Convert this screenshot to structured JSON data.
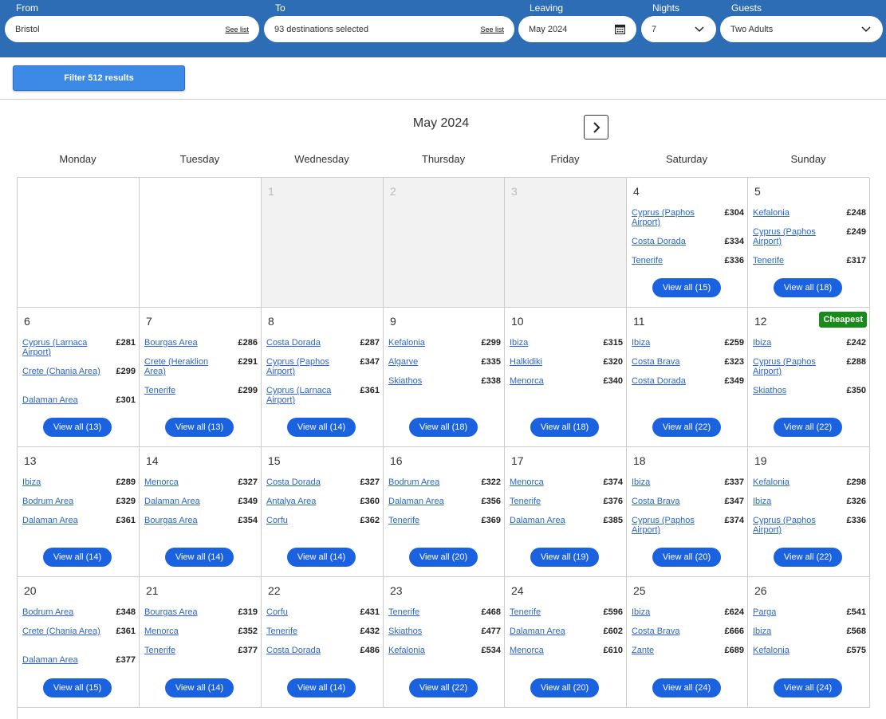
{
  "search": {
    "from": {
      "label": "From",
      "value": "Bristol",
      "see_list": "See list"
    },
    "to": {
      "label": "To",
      "value": "93 destinations selected",
      "see_list": "See list"
    },
    "leaving": {
      "label": "Leaving",
      "value": "May 2024",
      "icon": "calendar-icon"
    },
    "nights": {
      "label": "Nights",
      "value": "7",
      "icon": "chevron-down-icon"
    },
    "guests": {
      "label": "Guests",
      "value": "Two Adults",
      "icon": "chevron-down-icon"
    }
  },
  "filter_button": "Filter 512 results",
  "calendar": {
    "month": "May 2024",
    "next_icon": "chevron-right-icon",
    "weekdays": [
      "Monday",
      "Tuesday",
      "Wednesday",
      "Thursday",
      "Friday",
      "Saturday",
      "Sunday"
    ],
    "cheapest_label": "Cheapest",
    "weeks": [
      [
        {
          "day": "",
          "past": false,
          "entries": []
        },
        {
          "day": "",
          "past": false,
          "entries": []
        },
        {
          "day": "1",
          "past": true,
          "entries": []
        },
        {
          "day": "2",
          "past": true,
          "entries": []
        },
        {
          "day": "3",
          "past": true,
          "entries": []
        },
        {
          "day": "4",
          "past": false,
          "entries": [
            {
              "dest": "Cyprus (Paphos Airport)",
              "price": "£304"
            },
            {
              "dest": "Costa Dorada",
              "price": "£334"
            },
            {
              "dest": "Tenerife",
              "price": "£336"
            }
          ],
          "view_all": "View all (15)"
        },
        {
          "day": "5",
          "past": false,
          "entries": [
            {
              "dest": "Kefalonia",
              "price": "£248"
            },
            {
              "dest": "Cyprus (Paphos Airport)",
              "price": "£249"
            },
            {
              "dest": "Tenerife",
              "price": "£317"
            }
          ],
          "view_all": "View all (18)"
        }
      ],
      [
        {
          "day": "6",
          "past": false,
          "entries": [
            {
              "dest": "Cyprus (Larnaca Airport)",
              "price": "£281"
            },
            {
              "dest": "Crete (Chania Area)",
              "price": "£299"
            },
            {
              "dest": "Dalaman Area",
              "price": "£301"
            }
          ],
          "view_all": "View all (13)"
        },
        {
          "day": "7",
          "past": false,
          "entries": [
            {
              "dest": "Bourgas Area",
              "price": "£286"
            },
            {
              "dest": "Crete (Heraklion Area)",
              "price": "£291"
            },
            {
              "dest": "Tenerife",
              "price": "£299"
            }
          ],
          "view_all": "View all (13)"
        },
        {
          "day": "8",
          "past": false,
          "entries": [
            {
              "dest": "Costa Dorada",
              "price": "£287"
            },
            {
              "dest": "Cyprus (Paphos Airport)",
              "price": "£347"
            },
            {
              "dest": "Cyprus (Larnaca Airport)",
              "price": "£361"
            }
          ],
          "view_all": "View all (14)"
        },
        {
          "day": "9",
          "past": false,
          "entries": [
            {
              "dest": "Kefalonia",
              "price": "£299"
            },
            {
              "dest": "Algarve",
              "price": "£335"
            },
            {
              "dest": "Skiathos",
              "price": "£338"
            }
          ],
          "view_all": "View all (18)"
        },
        {
          "day": "10",
          "past": false,
          "entries": [
            {
              "dest": "Ibiza",
              "price": "£315"
            },
            {
              "dest": "Halkidiki",
              "price": "£320"
            },
            {
              "dest": "Menorca",
              "price": "£340"
            }
          ],
          "view_all": "View all (18)"
        },
        {
          "day": "11",
          "past": false,
          "entries": [
            {
              "dest": "Ibiza",
              "price": "£259"
            },
            {
              "dest": "Costa Brava",
              "price": "£323"
            },
            {
              "dest": "Costa Dorada",
              "price": "£349"
            }
          ],
          "view_all": "View all (22)"
        },
        {
          "day": "12",
          "past": false,
          "cheapest": true,
          "entries": [
            {
              "dest": "Ibiza",
              "price": "£242"
            },
            {
              "dest": "Cyprus (Paphos Airport)",
              "price": "£288"
            },
            {
              "dest": "Skiathos",
              "price": "£350"
            }
          ],
          "view_all": "View all (22)"
        }
      ],
      [
        {
          "day": "13",
          "past": false,
          "entries": [
            {
              "dest": "Ibiza",
              "price": "£289"
            },
            {
              "dest": "Bodrum Area",
              "price": "£329"
            },
            {
              "dest": "Dalaman Area",
              "price": "£361"
            }
          ],
          "view_all": "View all (14)"
        },
        {
          "day": "14",
          "past": false,
          "entries": [
            {
              "dest": "Menorca",
              "price": "£327"
            },
            {
              "dest": "Dalaman Area",
              "price": "£349"
            },
            {
              "dest": "Bourgas Area",
              "price": "£354"
            }
          ],
          "view_all": "View all (14)"
        },
        {
          "day": "15",
          "past": false,
          "entries": [
            {
              "dest": "Costa Dorada",
              "price": "£327"
            },
            {
              "dest": "Antalya Area",
              "price": "£360"
            },
            {
              "dest": "Corfu",
              "price": "£362"
            }
          ],
          "view_all": "View all (14)"
        },
        {
          "day": "16",
          "past": false,
          "entries": [
            {
              "dest": "Bodrum Area",
              "price": "£322"
            },
            {
              "dest": "Dalaman Area",
              "price": "£356"
            },
            {
              "dest": "Tenerife",
              "price": "£369"
            }
          ],
          "view_all": "View all (20)"
        },
        {
          "day": "17",
          "past": false,
          "entries": [
            {
              "dest": "Menorca",
              "price": "£374"
            },
            {
              "dest": "Tenerife",
              "price": "£376"
            },
            {
              "dest": "Dalaman Area",
              "price": "£385"
            }
          ],
          "view_all": "View all (19)"
        },
        {
          "day": "18",
          "past": false,
          "entries": [
            {
              "dest": "Ibiza",
              "price": "£337"
            },
            {
              "dest": "Costa Brava",
              "price": "£347"
            },
            {
              "dest": "Cyprus (Paphos Airport)",
              "price": "£374"
            }
          ],
          "view_all": "View all (20)"
        },
        {
          "day": "19",
          "past": false,
          "entries": [
            {
              "dest": "Kefalonia",
              "price": "£298"
            },
            {
              "dest": "Ibiza",
              "price": "£326"
            },
            {
              "dest": "Cyprus (Paphos Airport)",
              "price": "£336"
            }
          ],
          "view_all": "View all (22)"
        }
      ],
      [
        {
          "day": "20",
          "past": false,
          "entries": [
            {
              "dest": "Bodrum Area",
              "price": "£348"
            },
            {
              "dest": "Crete (Chania Area)",
              "price": "£361"
            },
            {
              "dest": "Dalaman Area",
              "price": "£377"
            }
          ],
          "view_all": "View all (15)"
        },
        {
          "day": "21",
          "past": false,
          "entries": [
            {
              "dest": "Bourgas Area",
              "price": "£319"
            },
            {
              "dest": "Menorca",
              "price": "£352"
            },
            {
              "dest": "Tenerife",
              "price": "£377"
            }
          ],
          "view_all": "View all (14)"
        },
        {
          "day": "22",
          "past": false,
          "entries": [
            {
              "dest": "Corfu",
              "price": "£431"
            },
            {
              "dest": "Tenerife",
              "price": "£432"
            },
            {
              "dest": "Costa Dorada",
              "price": "£486"
            }
          ],
          "view_all": "View all (14)"
        },
        {
          "day": "23",
          "past": false,
          "entries": [
            {
              "dest": "Tenerife",
              "price": "£468"
            },
            {
              "dest": "Skiathos",
              "price": "£477"
            },
            {
              "dest": "Kefalonia",
              "price": "£534"
            }
          ],
          "view_all": "View all (22)"
        },
        {
          "day": "24",
          "past": false,
          "entries": [
            {
              "dest": "Tenerife",
              "price": "£596"
            },
            {
              "dest": "Dalaman Area",
              "price": "£602"
            },
            {
              "dest": "Menorca",
              "price": "£610"
            }
          ],
          "view_all": "View all (20)"
        },
        {
          "day": "25",
          "past": false,
          "entries": [
            {
              "dest": "Ibiza",
              "price": "£624"
            },
            {
              "dest": "Costa Brava",
              "price": "£666"
            },
            {
              "dest": "Zante",
              "price": "£689"
            }
          ],
          "view_all": "View all (24)"
        },
        {
          "day": "26",
          "past": false,
          "entries": [
            {
              "dest": "Parga",
              "price": "£541"
            },
            {
              "dest": "Ibiza",
              "price": "£568"
            },
            {
              "dest": "Kefalonia",
              "price": "£575"
            }
          ],
          "view_all": "View all (24)"
        }
      ]
    ]
  }
}
